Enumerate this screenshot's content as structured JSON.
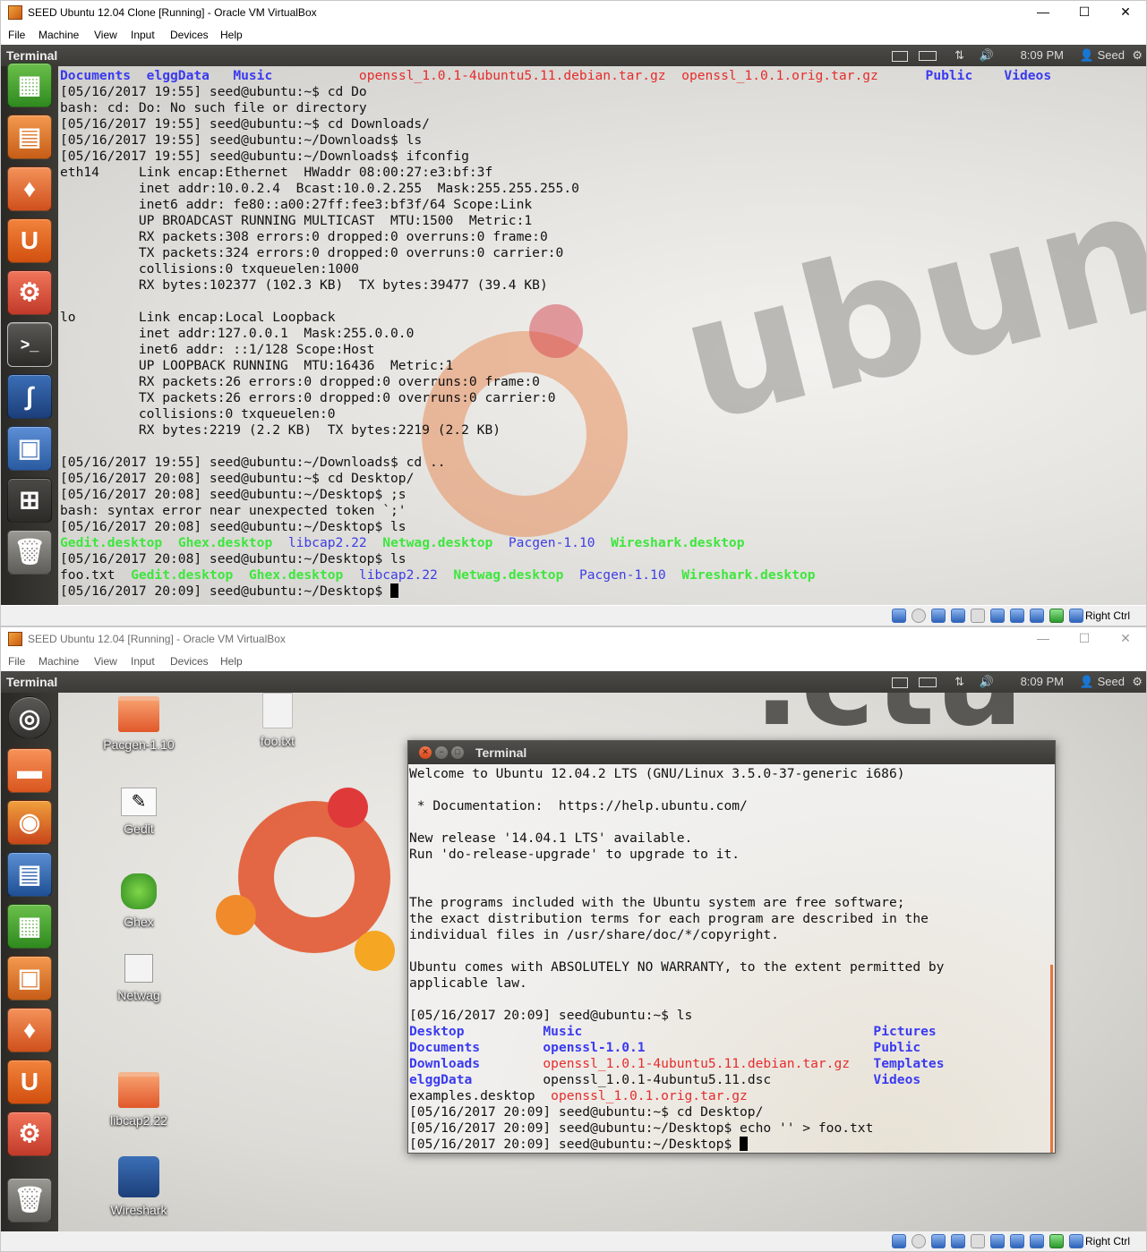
{
  "win1": {
    "title": "SEED Ubuntu 12.04 Clone [Running] - Oracle VM VirtualBox",
    "controls": {
      "minimize": "—",
      "maximize": "☐",
      "close": "✕"
    },
    "menu": [
      "File",
      "Machine",
      "View",
      "Input",
      "Devices",
      "Help"
    ],
    "panel": {
      "title": "Terminal",
      "time": "8:09 PM",
      "user": "Seed",
      "network": "⇅",
      "volume": "🔊",
      "gear": "⚙"
    },
    "terminal_lines": [
      [
        [
          "Documents",
          "dir"
        ],
        [
          "  ",
          ""
        ],
        [
          "elggData",
          "dir"
        ],
        [
          "   ",
          ""
        ],
        [
          "Music",
          "dir"
        ],
        [
          "           ",
          ""
        ],
        [
          "openssl_1.0.1-4ubuntu5.11.debian.tar.gz",
          "arch"
        ],
        [
          "  ",
          ""
        ],
        [
          "openssl_1.0.1.orig.tar.gz",
          "arch"
        ],
        [
          "      ",
          ""
        ],
        [
          "Public",
          "dir"
        ],
        [
          "    ",
          ""
        ],
        [
          "Videos",
          "dir"
        ]
      ],
      [
        [
          "[05/16/2017 19:55] seed@ubuntu:~$ cd Do",
          ""
        ]
      ],
      [
        [
          "bash: cd: Do: No such file or directory",
          ""
        ]
      ],
      [
        [
          "[05/16/2017 19:55] seed@ubuntu:~$ cd Downloads/",
          ""
        ]
      ],
      [
        [
          "[05/16/2017 19:55] seed@ubuntu:~/Downloads$ ls",
          ""
        ]
      ],
      [
        [
          "[05/16/2017 19:55] seed@ubuntu:~/Downloads$ ifconfig",
          ""
        ]
      ],
      [
        [
          "eth14     Link encap:Ethernet  HWaddr 08:00:27:e3:bf:3f",
          ""
        ]
      ],
      [
        [
          "          inet addr:10.0.2.4  Bcast:10.0.2.255  Mask:255.255.255.0",
          ""
        ]
      ],
      [
        [
          "          inet6 addr: fe80::a00:27ff:fee3:bf3f/64 Scope:Link",
          ""
        ]
      ],
      [
        [
          "          UP BROADCAST RUNNING MULTICAST  MTU:1500  Metric:1",
          ""
        ]
      ],
      [
        [
          "          RX packets:308 errors:0 dropped:0 overruns:0 frame:0",
          ""
        ]
      ],
      [
        [
          "          TX packets:324 errors:0 dropped:0 overruns:0 carrier:0",
          ""
        ]
      ],
      [
        [
          "          collisions:0 txqueuelen:1000",
          ""
        ]
      ],
      [
        [
          "          RX bytes:102377 (102.3 KB)  TX bytes:39477 (39.4 KB)",
          ""
        ]
      ],
      [
        [
          "",
          ""
        ]
      ],
      [
        [
          "lo        Link encap:Local Loopback",
          ""
        ]
      ],
      [
        [
          "          inet addr:127.0.0.1  Mask:255.0.0.0",
          ""
        ]
      ],
      [
        [
          "          inet6 addr: ::1/128 Scope:Host",
          ""
        ]
      ],
      [
        [
          "          UP LOOPBACK RUNNING  MTU:16436  Metric:1",
          ""
        ]
      ],
      [
        [
          "          RX packets:26 errors:0 dropped:0 overruns:0 frame:0",
          ""
        ]
      ],
      [
        [
          "          TX packets:26 errors:0 dropped:0 overruns:0 carrier:0",
          ""
        ]
      ],
      [
        [
          "          collisions:0 txqueuelen:0",
          ""
        ]
      ],
      [
        [
          "          RX bytes:2219 (2.2 KB)  TX bytes:2219 (2.2 KB)",
          ""
        ]
      ],
      [
        [
          "",
          ""
        ]
      ],
      [
        [
          "[05/16/2017 19:55] seed@ubuntu:~/Downloads$ cd ..",
          ""
        ]
      ],
      [
        [
          "[05/16/2017 20:08] seed@ubuntu:~$ cd Desktop/",
          ""
        ]
      ],
      [
        [
          "[05/16/2017 20:08] seed@ubuntu:~/Desktop$ ;s",
          ""
        ]
      ],
      [
        [
          "bash: syntax error near unexpected token `;'",
          ""
        ]
      ],
      [
        [
          "[05/16/2017 20:08] seed@ubuntu:~/Desktop$ ls",
          ""
        ]
      ],
      [
        [
          "Gedit.desktop",
          "exec"
        ],
        [
          "  ",
          ""
        ],
        [
          "Ghex.desktop",
          "exec"
        ],
        [
          "  ",
          ""
        ],
        [
          "libcap2.22",
          "blue"
        ],
        [
          "  ",
          ""
        ],
        [
          "Netwag.desktop",
          "exec"
        ],
        [
          "  ",
          ""
        ],
        [
          "Pacgen-1.10",
          "blue"
        ],
        [
          "  ",
          ""
        ],
        [
          "Wireshark.desktop",
          "exec"
        ]
      ],
      [
        [
          "[05/16/2017 20:08] seed@ubuntu:~/Desktop$ ls",
          ""
        ]
      ],
      [
        [
          "foo.txt  ",
          ""
        ],
        [
          "Gedit.desktop",
          "exec"
        ],
        [
          "  ",
          ""
        ],
        [
          "Ghex.desktop",
          "exec"
        ],
        [
          "  ",
          ""
        ],
        [
          "libcap2.22",
          "blue"
        ],
        [
          "  ",
          ""
        ],
        [
          "Netwag.desktop",
          "exec"
        ],
        [
          "  ",
          ""
        ],
        [
          "Pacgen-1.10",
          "blue"
        ],
        [
          "  ",
          ""
        ],
        [
          "Wireshark.desktop",
          "exec"
        ]
      ],
      [
        [
          "[05/16/2017 20:09] seed@ubuntu:~/Desktop$ ",
          ""
        ]
      ]
    ],
    "status": {
      "host_key": "Right Ctrl"
    }
  },
  "win2": {
    "title": "SEED Ubuntu 12.04 [Running] - Oracle VM VirtualBox",
    "controls": {
      "minimize": "—",
      "maximize": "☐",
      "close": "✕"
    },
    "menu": [
      "File",
      "Machine",
      "View",
      "Input",
      "Devices",
      "Help"
    ],
    "panel": {
      "title": "Terminal",
      "time": "8:09 PM",
      "user": "Seed",
      "network": "⇅",
      "volume": "🔊",
      "gear": "⚙"
    },
    "desktop_icons": [
      "Pacgen-1.10",
      "foo.txt",
      "Gedit",
      "Ghex",
      "Netwag",
      "libcap2.22",
      "Wireshark"
    ],
    "terminal": {
      "title": "Terminal",
      "lines": [
        [
          [
            "Welcome to Ubuntu 12.04.2 LTS (GNU/Linux 3.5.0-37-generic i686)",
            ""
          ]
        ],
        [
          [
            "",
            ""
          ]
        ],
        [
          [
            " * Documentation:  https://help.ubuntu.com/",
            ""
          ]
        ],
        [
          [
            "",
            ""
          ]
        ],
        [
          [
            "New release '14.04.1 LTS' available.",
            ""
          ]
        ],
        [
          [
            "Run 'do-release-upgrade' to upgrade to it.",
            ""
          ]
        ],
        [
          [
            "",
            ""
          ]
        ],
        [
          [
            "",
            ""
          ]
        ],
        [
          [
            "The programs included with the Ubuntu system are free software;",
            ""
          ]
        ],
        [
          [
            "the exact distribution terms for each program are described in the",
            ""
          ]
        ],
        [
          [
            "individual files in /usr/share/doc/*/copyright.",
            ""
          ]
        ],
        [
          [
            "",
            ""
          ]
        ],
        [
          [
            "Ubuntu comes with ABSOLUTELY NO WARRANTY, to the extent permitted by",
            ""
          ]
        ],
        [
          [
            "applicable law.",
            ""
          ]
        ],
        [
          [
            "",
            ""
          ]
        ],
        [
          [
            "[05/16/2017 20:09] seed@ubuntu:~$ ls",
            ""
          ]
        ],
        [
          [
            "Desktop",
            "dir"
          ],
          [
            "          ",
            ""
          ],
          [
            "Music",
            "dir"
          ],
          [
            "                                     ",
            ""
          ],
          [
            "Pictures",
            "dir"
          ]
        ],
        [
          [
            "Documents",
            "dir"
          ],
          [
            "        ",
            ""
          ],
          [
            "openssl-1.0.1",
            "dir"
          ],
          [
            "                             ",
            ""
          ],
          [
            "Public",
            "dir"
          ]
        ],
        [
          [
            "Downloads",
            "dir"
          ],
          [
            "        ",
            ""
          ],
          [
            "openssl_1.0.1-4ubuntu5.11.debian.tar.gz",
            "arch"
          ],
          [
            "   ",
            ""
          ],
          [
            "Templates",
            "dir"
          ]
        ],
        [
          [
            "elggData",
            "dir"
          ],
          [
            "         ",
            ""
          ],
          [
            "openssl_1.0.1-4ubuntu5.11.dsc",
            ""
          ],
          [
            "             ",
            ""
          ],
          [
            "Videos",
            "dir"
          ]
        ],
        [
          [
            "examples.desktop  ",
            ""
          ],
          [
            "openssl_1.0.1.orig.tar.gz",
            "arch"
          ]
        ],
        [
          [
            "[05/16/2017 20:09] seed@ubuntu:~$ cd Desktop/",
            ""
          ]
        ],
        [
          [
            "[05/16/2017 20:09] seed@ubuntu:~/Desktop$ echo '' > foo.txt",
            ""
          ]
        ],
        [
          [
            "[05/16/2017 20:09] seed@ubuntu:~/Desktop$ ",
            ""
          ]
        ]
      ]
    },
    "status": {
      "host_key": "Right Ctrl"
    }
  },
  "colors": {
    "dir": "#3a3af0",
    "archive": "#e52c2c",
    "exec": "#3ee63e",
    "panel": "#3c3b37",
    "launcher": "#2f2e2a"
  },
  "icons": {
    "launcher_top": [
      "libreoffice-calc-icon",
      "libreoffice-impress-icon",
      "software-center-icon",
      "ubuntu-one-icon",
      "system-settings-icon",
      "terminal-icon",
      "wireshark-icon",
      "screenshot-icon",
      "workspace-switcher-icon",
      "trash-icon"
    ],
    "launcher_bottom": [
      "dash-home-icon",
      "files-icon",
      "firefox-icon",
      "libreoffice-writer-icon",
      "libreoffice-calc-icon",
      "libreoffice-impress-icon",
      "software-center-icon",
      "ubuntu-one-icon",
      "system-settings-icon",
      "trash-icon"
    ]
  }
}
